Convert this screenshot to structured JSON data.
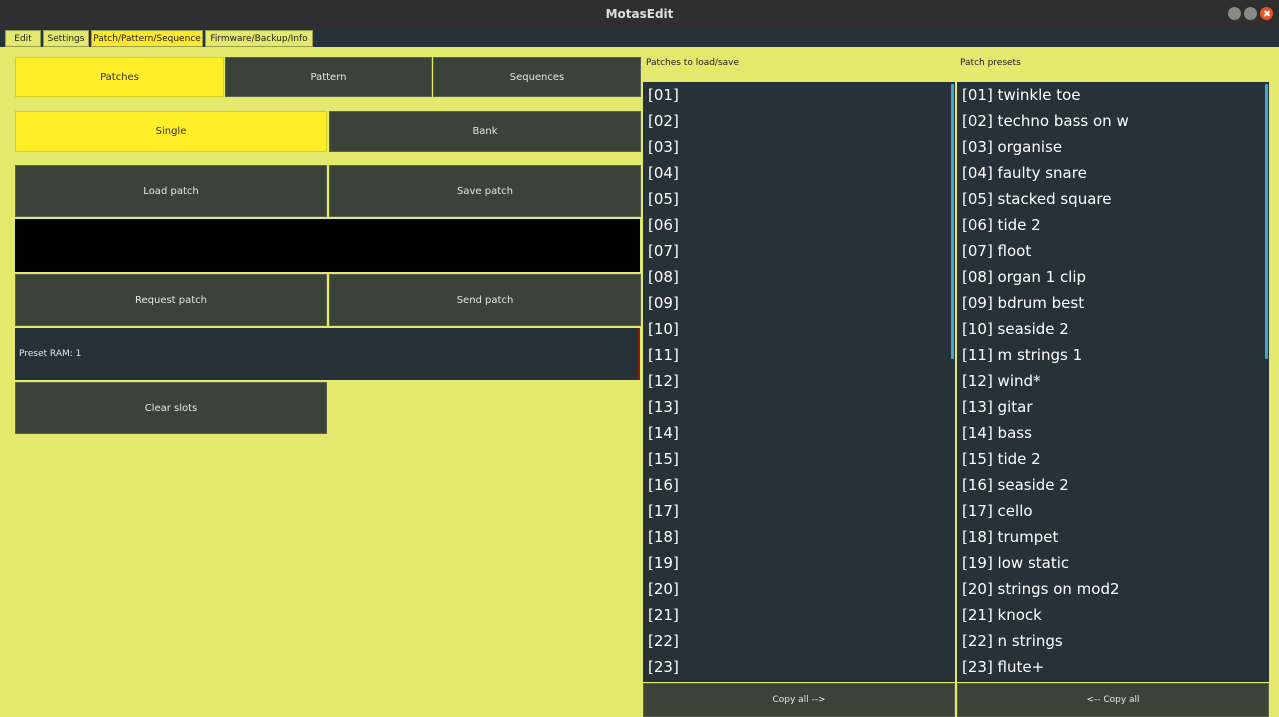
{
  "window": {
    "title": "MotasEdit"
  },
  "tabs": [
    "Edit",
    "Settings",
    "Patch/Pattern/Sequence",
    "Firmware/Backup/Info"
  ],
  "mode_buttons": {
    "patches": "Patches",
    "pattern": "Pattern",
    "sequences": "Sequences"
  },
  "scope_buttons": {
    "single": "Single",
    "bank": "Bank"
  },
  "actions": {
    "load_patch": "Load patch",
    "save_patch": "Save patch",
    "request_patch": "Request patch",
    "send_patch": "Send patch",
    "clear_slots": "Clear slots"
  },
  "preset_ram": "Preset RAM: 1",
  "patches_panel": {
    "header": "Patches to load/save",
    "items": [
      "[01]",
      "[02]",
      "[03]",
      "[04]",
      "[05]",
      "[06]",
      "[07]",
      "[08]",
      "[09]",
      "[10]",
      "[11]",
      "[12]",
      "[13]",
      "[14]",
      "[15]",
      "[16]",
      "[17]",
      "[18]",
      "[19]",
      "[20]",
      "[21]",
      "[22]",
      "[23]"
    ],
    "copy_button": "Copy all -->"
  },
  "presets_panel": {
    "header": "Patch presets",
    "items": [
      "[01] twinkle toe",
      "[02] techno bass on w",
      "[03] organise",
      "[04] faulty snare",
      "[05] stacked square",
      "[06] tide 2",
      "[07] floot",
      "[08] organ 1 clip",
      "[09] bdrum best",
      "[10] seaside 2",
      "[11] m strings 1",
      "[12] wind*",
      "[13] gitar",
      "[14] bass",
      "[15] tide 2",
      "[16] seaside 2",
      "[17] cello",
      "[18] trumpet",
      "[19] low static",
      "[20] strings on mod2",
      "[21] knock",
      "[22] n strings",
      "[23] flute+"
    ],
    "copy_button": "<-- Copy all"
  },
  "colors": {
    "background": "#e3e96c",
    "active": "#ffee28",
    "button": "#3b4339",
    "list": "#263238",
    "scroll": "#3fa4d6"
  }
}
